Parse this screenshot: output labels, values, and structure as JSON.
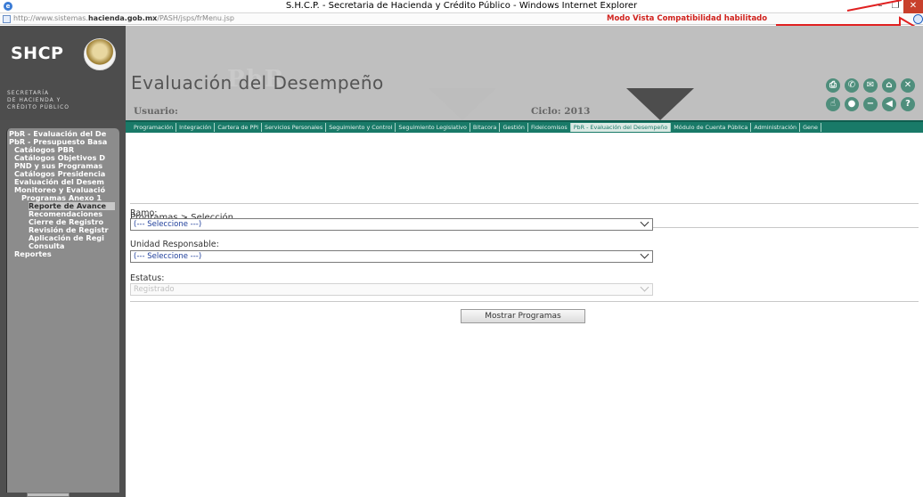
{
  "window": {
    "title": "S.H.C.P. - Secretaria de Hacienda y Crédito Público - Windows Internet Explorer",
    "minimize": "–",
    "maximize": "❐",
    "close": "✕"
  },
  "address": {
    "url_prefix": "http://www.sistemas.",
    "url_domain": "hacienda.gob.mx",
    "url_path": "/PASH/jsps/frMenu.jsp",
    "compat_message": "Modo Vista Compatibilidad habilitado"
  },
  "header": {
    "logo": "SHCP",
    "secretaria_lines": [
      "SECRETARÍA",
      "DE HACIENDA Y",
      "CRÉDITO PÚBLICO"
    ],
    "app_title": "Evaluación del Desempeño",
    "ghost_text": "PbR",
    "usuario_label": "Usuario:",
    "ciclo_label": "Ciclo: 2013"
  },
  "toolbar_icons": [
    "print-icon",
    "phone-icon",
    "mail-icon",
    "home-icon",
    "close-icon",
    "thumb-icon",
    "record-icon",
    "minus-icon",
    "back-icon",
    "help-icon"
  ],
  "tabs": [
    "Programación",
    "Integración",
    "Cartera de PPI",
    "Servicios Personales",
    "Seguimiento y Control",
    "Seguimiento Legislativo",
    "Bitacora",
    "Gestión",
    "Fideicomisos",
    "PbR - Evaluación del Desempeño",
    "Módulo de Cuenta Pública",
    "Administración",
    "Gene"
  ],
  "active_tab": 9,
  "sidebar": {
    "items": [
      {
        "label": "PbR - Evaluación del De"
      },
      {
        "label": "PbR - Presupuesto Basa"
      },
      {
        "label": "Catálogos PBR"
      },
      {
        "label": "Catálogos Objetivos D"
      },
      {
        "label": "PND y sus Programas"
      },
      {
        "label": "Catálogos Presidencia"
      },
      {
        "label": "Evaluación del Desem"
      },
      {
        "label": "Monitoreo y Evaluació"
      },
      {
        "label": "Programas Anexo 1"
      },
      {
        "label": "Reporte de Avance"
      },
      {
        "label": "Recomendaciones"
      },
      {
        "label": "Cierre de Registro"
      },
      {
        "label": "Revisión de Registr"
      },
      {
        "label": "Aplicación de Regi"
      },
      {
        "label": "Consulta"
      },
      {
        "label": "Reportes"
      }
    ],
    "selected_index": 9
  },
  "main": {
    "breadcrumb": "Programas > Selección",
    "ramo_label": "Ramo:",
    "ramo_value": "(--- Seleccione ---)",
    "unidad_label": "Unidad Responsable:",
    "unidad_value": "(--- Seleccione ---)",
    "estatus_label": "Estatus:",
    "estatus_value": "Registrado",
    "button_label": "Mostrar Programas"
  }
}
